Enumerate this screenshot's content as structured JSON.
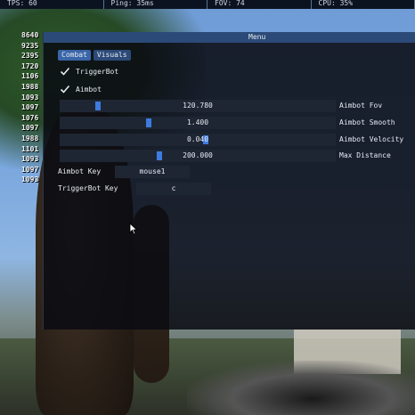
{
  "topbar": {
    "cells": [
      "TPS: 60",
      "Ping: 35ms",
      "FOV: 74",
      "CPU: 35%"
    ]
  },
  "log": {
    "lines": [
      "8640",
      "9235",
      "2395",
      "1720",
      "1106",
      "1988",
      "1093",
      "1097",
      "1076",
      "1097",
      "1988",
      "1101",
      "1093",
      "1097",
      "1093"
    ]
  },
  "menu": {
    "title": "Menu",
    "tabs": [
      {
        "label": "Combat",
        "active": true
      },
      {
        "label": "Visuals",
        "active": false
      }
    ],
    "checkboxes": [
      {
        "label": "TriggerBot",
        "checked": true
      },
      {
        "label": "Aimbot",
        "checked": true
      }
    ],
    "sliders": [
      {
        "label": "Aimbot Fov",
        "value": "120.780",
        "fraction": 0.13
      },
      {
        "label": "Aimbot Smooth",
        "value": "1.400",
        "fraction": 0.32
      },
      {
        "label": "Aimbot Velocity",
        "value": "0.040",
        "fraction": 0.53
      },
      {
        "label": "Max Distance",
        "value": "200.000",
        "fraction": 0.36
      }
    ],
    "keybinds": [
      {
        "label": "Aimbot Key",
        "value": "mouse1"
      },
      {
        "label": "TriggerBot Key",
        "value": "c"
      }
    ]
  },
  "colors": {
    "accent": "#3d7be0",
    "titlebar": "#2b4a78",
    "window_bg": "#0a0c12"
  },
  "icons": [
    "checkmark-icon",
    "mouse-cursor-icon"
  ]
}
